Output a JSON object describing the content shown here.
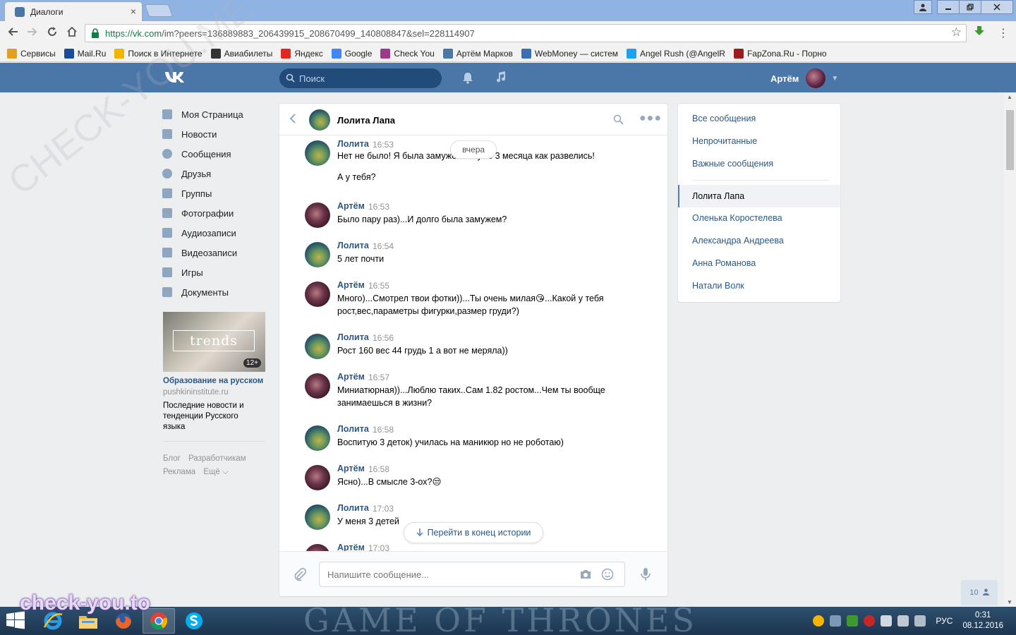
{
  "browser": {
    "tab_title": "Диалоги",
    "tab_close": "×",
    "url_host": "https://vk.com",
    "url_path": "/im?peers=136889883_206439915_208670499_140808847&sel=228114907",
    "bookmarks": [
      {
        "label": "Сервисы",
        "color": "#e0a020"
      },
      {
        "label": "Mail.Ru",
        "color": "#1a4c9c"
      },
      {
        "label": "Поиск в Интернете",
        "color": "#f2b400"
      },
      {
        "label": "Авиабилеты",
        "color": "#333333"
      },
      {
        "label": "Яндекс",
        "color": "#e52620"
      },
      {
        "label": "Google",
        "color": "#4285f4"
      },
      {
        "label": "Check You",
        "color": "#9b3a8a"
      },
      {
        "label": "Артём Марков",
        "color": "#4a76a8"
      },
      {
        "label": "WebMoney — систем",
        "color": "#3b6fb5"
      },
      {
        "label": "Angel Rush (@AngelR",
        "color": "#1da1f2"
      },
      {
        "label": "FapZona.Ru - Порно",
        "color": "#9b1c1c"
      }
    ]
  },
  "vk": {
    "logo": "ВК",
    "search_placeholder": "Поиск",
    "user_name": "Артём",
    "accent": "#4a76a8"
  },
  "left_menu": [
    {
      "label": "Моя Страница",
      "icon": "home-icon"
    },
    {
      "label": "Новости",
      "icon": "news-icon"
    },
    {
      "label": "Сообщения",
      "icon": "messages-icon"
    },
    {
      "label": "Друзья",
      "icon": "friends-icon"
    },
    {
      "label": "Группы",
      "icon": "groups-icon"
    },
    {
      "label": "Фотографии",
      "icon": "camera-icon"
    },
    {
      "label": "Аудиозаписи",
      "icon": "music-icon"
    },
    {
      "label": "Видеозаписи",
      "icon": "video-icon"
    },
    {
      "label": "Игры",
      "icon": "gamepad-icon"
    },
    {
      "label": "Документы",
      "icon": "document-icon"
    }
  ],
  "promo": {
    "image_text": "trends",
    "age": "12+",
    "title": "Образование на русском",
    "domain": "pushkininstitute.ru",
    "description": "Последние новости и тенденции Русского языка"
  },
  "footer_links": [
    "Блог",
    "Разработчикам",
    "Реклама",
    "Ещё ⌵"
  ],
  "chat": {
    "title": "Лолита Лапа",
    "date_pill": "вчера",
    "jump_label": "Перейти в конец истории",
    "input_placeholder": "Напишите сообщение...",
    "messages": [
      {
        "author": "Лолита",
        "time": "16:53",
        "text": "Нет не было! Я была замужем но уже 3 месяца как развелись!\n\nА у тебя?",
        "who": "lolita"
      },
      {
        "author": "Артём",
        "time": "16:53",
        "text": "Было пару раз)...И долго была замужем?",
        "who": "artem"
      },
      {
        "author": "Лолита",
        "time": "16:54",
        "text": "5 лет почти",
        "who": "lolita"
      },
      {
        "author": "Артём",
        "time": "16:55",
        "text": "Много)...Смотрел твои фотки))...Ты очень милая😘...Какой у тебя рост,вес,параметры фигурки,размер груди?)",
        "who": "artem"
      },
      {
        "author": "Лолита",
        "time": "16:56",
        "text": "Рост 160 вес 44 грудь 1 а вот не меряла))",
        "who": "lolita"
      },
      {
        "author": "Артём",
        "time": "16:57",
        "text": "Миниатюрная))...Люблю таких..Сам 1.82 ростом...Чем ты вообще занимаешься в жизни?",
        "who": "artem"
      },
      {
        "author": "Лолита",
        "time": "16:58",
        "text": "Воспитую 3 деток) училась на маникюр но не роботаю)",
        "who": "lolita"
      },
      {
        "author": "Артём",
        "time": "16:58",
        "text": "Ясно)...В смысле 3-ох?😒",
        "who": "artem"
      },
      {
        "author": "Лолита",
        "time": "17:03",
        "text": "У меня 3 детей",
        "who": "lolita"
      },
      {
        "author": "Артём",
        "time": "17:03",
        "text": "",
        "who": "artem"
      }
    ]
  },
  "right_panel": {
    "filters": [
      "Все сообщения",
      "Непрочитанные",
      "Важные сообщения"
    ],
    "dialogs": [
      "Лолита Лапа",
      "Оленька Коростелева",
      "Александра Андреева",
      "Анна Романова",
      "Натали Волк"
    ]
  },
  "online_count": "10",
  "watermark_diag": "CHECK-YOU.ME",
  "watermark_bottom": "check-you.to",
  "taskbar": {
    "wallpaper_text": "GAME OF THRONES",
    "lang": "РУС",
    "time": "0:31",
    "date": "08.12.2016"
  }
}
